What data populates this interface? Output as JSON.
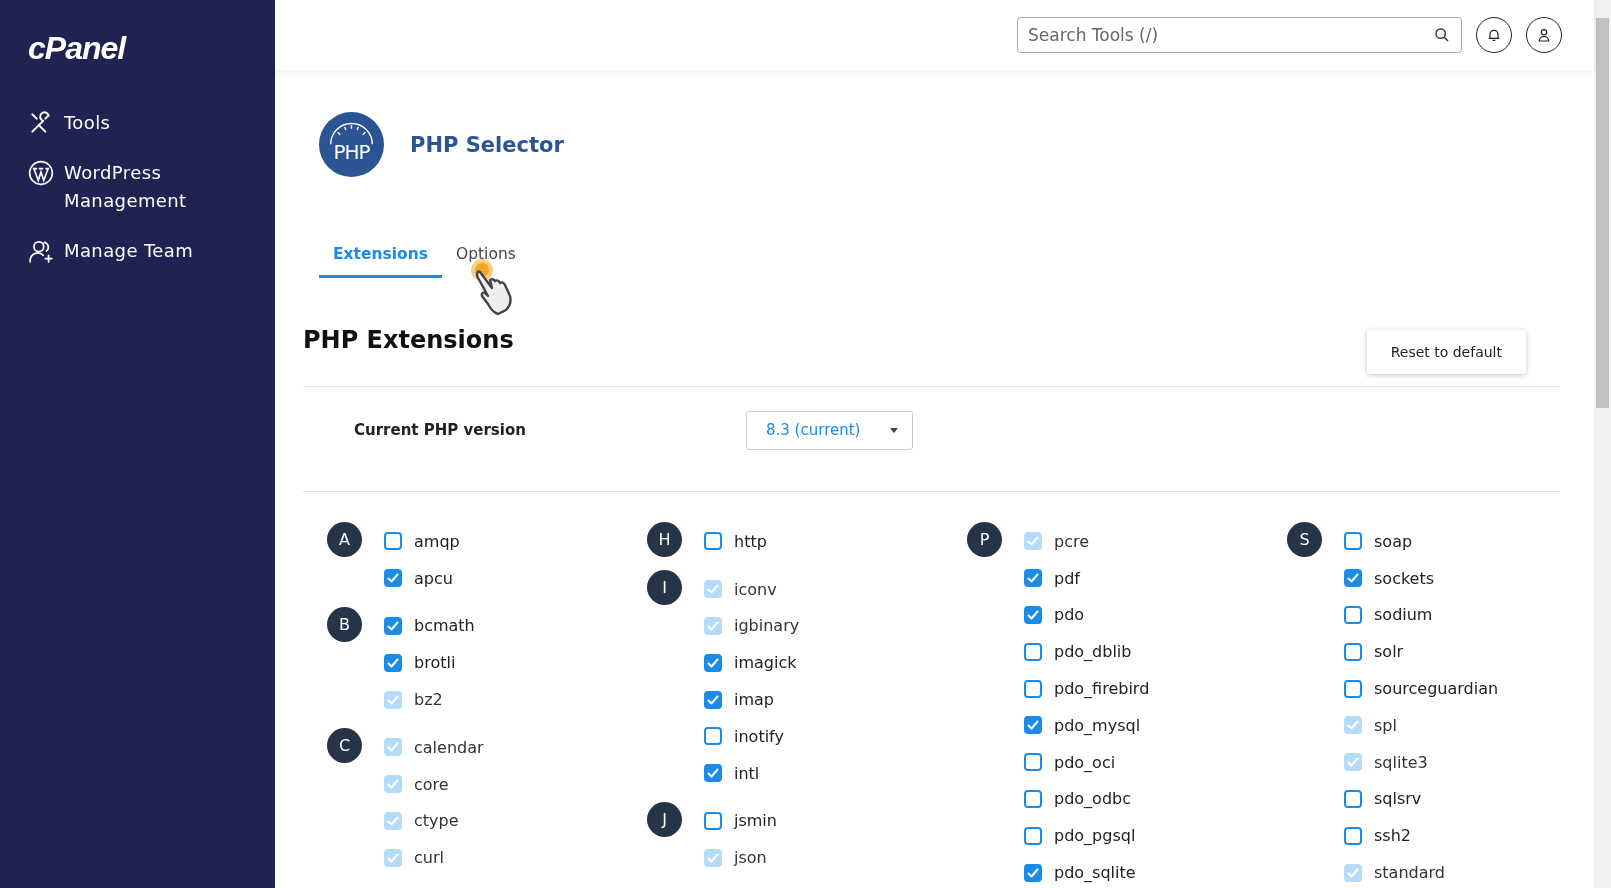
{
  "sidebar": {
    "logo": "cPanel",
    "items": [
      {
        "label": "Tools",
        "selected": false
      },
      {
        "label": "WordPress Management",
        "selected": false
      },
      {
        "label": "Manage Team",
        "selected": false
      }
    ]
  },
  "topbar": {
    "search": {
      "placeholder": "Search Tools (/)"
    }
  },
  "header": {
    "icon_text": "PHP",
    "title": "PHP Selector"
  },
  "tabs": [
    {
      "label": "Extensions",
      "selected": true
    },
    {
      "label": "Options",
      "selected": false
    }
  ],
  "section": {
    "title": "PHP Extensions",
    "reset_button": "Reset to default"
  },
  "version": {
    "label": "Current PHP version",
    "value": "8.3 (current)"
  },
  "columns": [
    [
      {
        "letter": "A",
        "items": [
          {
            "name": "amqp",
            "checked": false,
            "disabled": false
          },
          {
            "name": "apcu",
            "checked": true,
            "disabled": false
          }
        ]
      },
      {
        "letter": "B",
        "items": [
          {
            "name": "bcmath",
            "checked": true,
            "disabled": false
          },
          {
            "name": "brotli",
            "checked": true,
            "disabled": false
          },
          {
            "name": "bz2",
            "checked": true,
            "disabled": true
          }
        ]
      },
      {
        "letter": "C",
        "items": [
          {
            "name": "calendar",
            "checked": true,
            "disabled": true
          },
          {
            "name": "core",
            "checked": true,
            "disabled": true
          },
          {
            "name": "ctype",
            "checked": true,
            "disabled": true
          },
          {
            "name": "curl",
            "checked": true,
            "disabled": true
          }
        ]
      }
    ],
    [
      {
        "letter": "H",
        "items": [
          {
            "name": "http",
            "checked": false,
            "disabled": false
          }
        ]
      },
      {
        "letter": "I",
        "items": [
          {
            "name": "iconv",
            "checked": true,
            "disabled": true
          },
          {
            "name": "igbinary",
            "checked": true,
            "disabled": true
          },
          {
            "name": "imagick",
            "checked": true,
            "disabled": false
          },
          {
            "name": "imap",
            "checked": true,
            "disabled": false
          },
          {
            "name": "inotify",
            "checked": false,
            "disabled": false
          },
          {
            "name": "intl",
            "checked": true,
            "disabled": false
          }
        ]
      },
      {
        "letter": "J",
        "items": [
          {
            "name": "jsmin",
            "checked": false,
            "disabled": false
          },
          {
            "name": "json",
            "checked": true,
            "disabled": true
          }
        ]
      }
    ],
    [
      {
        "letter": "P",
        "items": [
          {
            "name": "pcre",
            "checked": true,
            "disabled": true
          },
          {
            "name": "pdf",
            "checked": true,
            "disabled": false
          },
          {
            "name": "pdo",
            "checked": true,
            "disabled": false
          },
          {
            "name": "pdo_dblib",
            "checked": false,
            "disabled": false
          },
          {
            "name": "pdo_firebird",
            "checked": false,
            "disabled": false
          },
          {
            "name": "pdo_mysql",
            "checked": true,
            "disabled": false
          },
          {
            "name": "pdo_oci",
            "checked": false,
            "disabled": false
          },
          {
            "name": "pdo_odbc",
            "checked": false,
            "disabled": false
          },
          {
            "name": "pdo_pgsql",
            "checked": false,
            "disabled": false
          },
          {
            "name": "pdo_sqlite",
            "checked": true,
            "disabled": false
          }
        ]
      }
    ],
    [
      {
        "letter": "S",
        "items": [
          {
            "name": "soap",
            "checked": false,
            "disabled": false
          },
          {
            "name": "sockets",
            "checked": true,
            "disabled": false
          },
          {
            "name": "sodium",
            "checked": false,
            "disabled": false
          },
          {
            "name": "solr",
            "checked": false,
            "disabled": false
          },
          {
            "name": "sourceguardian",
            "checked": false,
            "disabled": false
          },
          {
            "name": "spl",
            "checked": true,
            "disabled": true
          },
          {
            "name": "sqlite3",
            "checked": true,
            "disabled": true
          },
          {
            "name": "sqlsrv",
            "checked": false,
            "disabled": false
          },
          {
            "name": "ssh2",
            "checked": false,
            "disabled": false
          },
          {
            "name": "standard",
            "checked": true,
            "disabled": true
          }
        ]
      }
    ]
  ]
}
